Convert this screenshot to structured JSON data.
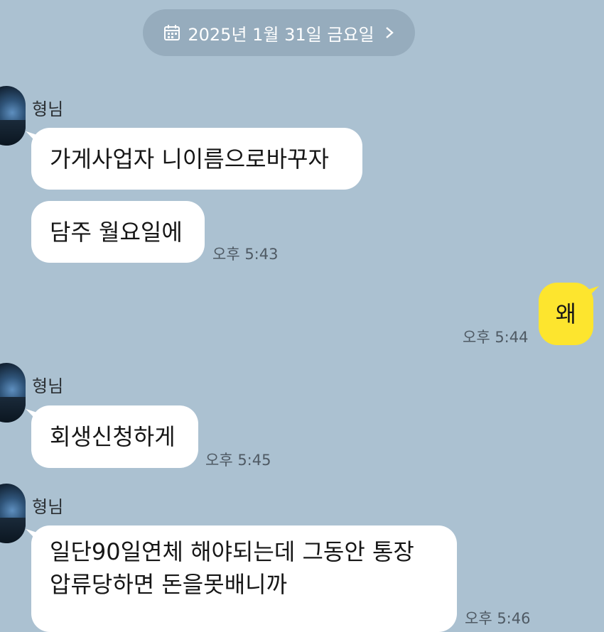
{
  "date_header": {
    "label": "2025년 1월 31일 금요일"
  },
  "messages": [
    {
      "sender": "형님",
      "bubbles": [
        "가게사업자 니이름으로바꾸자",
        "담주 월요일에"
      ],
      "time": "오후 5:43"
    },
    {
      "me": true,
      "text": "왜",
      "time": "오후 5:44"
    },
    {
      "sender": "형님",
      "bubbles": [
        "회생신청하게"
      ],
      "time": "오후 5:45"
    },
    {
      "sender": "형님",
      "lines": [
        "일단90일연체 해야되는데 그동안 통장",
        "압류당하면 돈을못배니까"
      ],
      "time": "오후 5:46"
    }
  ],
  "colors": {
    "background": "#abc1d1",
    "date_pill": "#96acbd",
    "incoming_bubble": "#ffffff",
    "outgoing_bubble": "#fde52e"
  },
  "icons": [
    "calendar-icon",
    "chevron-right-icon"
  ]
}
